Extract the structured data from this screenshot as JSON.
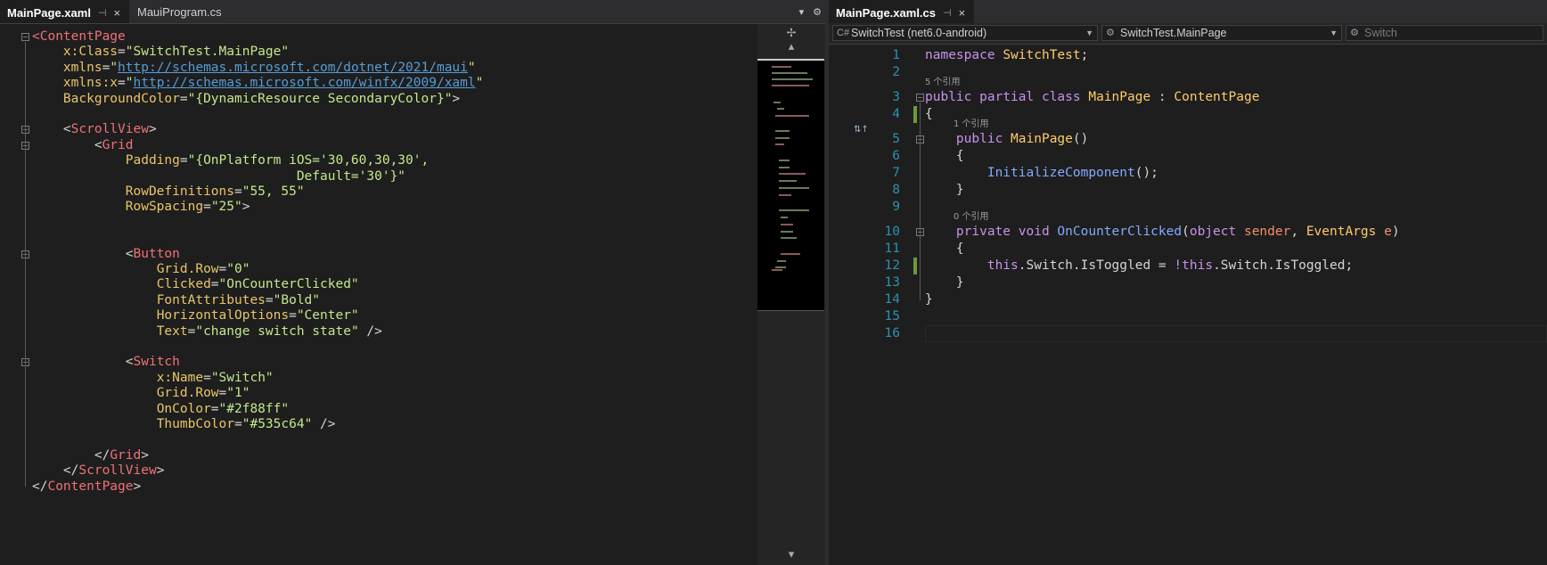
{
  "left": {
    "tabs": [
      {
        "label": "MainPage.xaml",
        "active": true
      },
      {
        "label": "MauiProgram.cs",
        "active": false
      }
    ],
    "tools": {
      "dropdown_icon": "chevron-down-icon",
      "settings_icon": "gear-icon"
    },
    "lines": [
      [
        [
          "<",
          "xt"
        ],
        [
          "ContentPage",
          "xt"
        ]
      ],
      [
        [
          "    ",
          ""
        ],
        [
          "x:Class",
          "xp"
        ],
        [
          "=",
          ""
        ],
        [
          "\"SwitchTest.MainPage\"",
          "xs"
        ]
      ],
      [
        [
          "    ",
          ""
        ],
        [
          "xmlns",
          "xp"
        ],
        [
          "=",
          ""
        ],
        [
          "\"",
          "xs"
        ],
        [
          "http://schemas.microsoft.com/dotnet/2021/maui",
          "xu"
        ],
        [
          "\"",
          "xs"
        ]
      ],
      [
        [
          "    ",
          ""
        ],
        [
          "xmlns:x",
          "xp"
        ],
        [
          "=",
          ""
        ],
        [
          "\"",
          "xs"
        ],
        [
          "http://schemas.microsoft.com/winfx/2009/xaml",
          "xu"
        ],
        [
          "\"",
          "xs"
        ]
      ],
      [
        [
          "    ",
          ""
        ],
        [
          "BackgroundColor",
          "xp"
        ],
        [
          "=",
          ""
        ],
        [
          "\"{DynamicResource SecondaryColor}\"",
          "xs"
        ],
        [
          ">",
          "xd"
        ]
      ],
      [],
      [
        [
          "    ",
          ""
        ],
        [
          "<",
          "xd"
        ],
        [
          "ScrollView",
          "xt"
        ],
        [
          ">",
          "xd"
        ]
      ],
      [
        [
          "        ",
          ""
        ],
        [
          "<",
          "xd"
        ],
        [
          "Grid",
          "xt"
        ]
      ],
      [
        [
          "            ",
          ""
        ],
        [
          "Padding",
          "xp"
        ],
        [
          "=",
          ""
        ],
        [
          "\"{OnPlatform iOS='30,60,30,30',",
          "xs"
        ]
      ],
      [
        [
          "                                  ",
          ""
        ],
        [
          "Default='30'}\"",
          "xs"
        ]
      ],
      [
        [
          "            ",
          ""
        ],
        [
          "RowDefinitions",
          "xp"
        ],
        [
          "=",
          ""
        ],
        [
          "\"55, 55\"",
          "xs"
        ]
      ],
      [
        [
          "            ",
          ""
        ],
        [
          "RowSpacing",
          "xp"
        ],
        [
          "=",
          ""
        ],
        [
          "\"25\"",
          "xs"
        ],
        [
          ">",
          "xd"
        ]
      ],
      [],
      [],
      [
        [
          "            ",
          ""
        ],
        [
          "<",
          "xd"
        ],
        [
          "Button",
          "xt"
        ]
      ],
      [
        [
          "                ",
          ""
        ],
        [
          "Grid.Row",
          "xp"
        ],
        [
          "=",
          ""
        ],
        [
          "\"0\"",
          "xs"
        ]
      ],
      [
        [
          "                ",
          ""
        ],
        [
          "Clicked",
          "xp"
        ],
        [
          "=",
          ""
        ],
        [
          "\"OnCounterClicked\"",
          "xs"
        ]
      ],
      [
        [
          "                ",
          ""
        ],
        [
          "FontAttributes",
          "xp"
        ],
        [
          "=",
          ""
        ],
        [
          "\"Bold\"",
          "xs"
        ]
      ],
      [
        [
          "                ",
          ""
        ],
        [
          "HorizontalOptions",
          "xp"
        ],
        [
          "=",
          ""
        ],
        [
          "\"Center\"",
          "xs"
        ]
      ],
      [
        [
          "                ",
          ""
        ],
        [
          "Text",
          "xp"
        ],
        [
          "=",
          ""
        ],
        [
          "\"change switch state\"",
          "xs"
        ],
        [
          " />",
          "xd"
        ]
      ],
      [],
      [
        [
          "            ",
          ""
        ],
        [
          "<",
          "xd"
        ],
        [
          "Switch",
          "xt"
        ]
      ],
      [
        [
          "                ",
          ""
        ],
        [
          "x:Name",
          "xp"
        ],
        [
          "=",
          ""
        ],
        [
          "\"Switch\"",
          "xs"
        ]
      ],
      [
        [
          "                ",
          ""
        ],
        [
          "Grid.Row",
          "xp"
        ],
        [
          "=",
          ""
        ],
        [
          "\"1\"",
          "xs"
        ]
      ],
      [
        [
          "                ",
          ""
        ],
        [
          "OnColor",
          "xp"
        ],
        [
          "=",
          ""
        ],
        [
          "\"#2f88ff\"",
          "xs"
        ]
      ],
      [
        [
          "                ",
          ""
        ],
        [
          "ThumbColor",
          "xp"
        ],
        [
          "=",
          ""
        ],
        [
          "\"#535c64\"",
          "xs"
        ],
        [
          " />",
          "xd"
        ]
      ],
      [],
      [
        [
          "        ",
          ""
        ],
        [
          "</",
          "xd"
        ],
        [
          "Grid",
          "xt"
        ],
        [
          ">",
          "xd"
        ]
      ],
      [
        [
          "    ",
          ""
        ],
        [
          "</",
          "xd"
        ],
        [
          "ScrollView",
          "xt"
        ],
        [
          ">",
          "xd"
        ]
      ],
      [
        [
          "</",
          "xd"
        ],
        [
          "ContentPage",
          "xt"
        ],
        [
          ">",
          "xd"
        ]
      ]
    ]
  },
  "right": {
    "tabs": [
      {
        "label": "MainPage.xaml.cs",
        "active": true
      }
    ],
    "nav": {
      "project": "SwitchTest (net6.0-android)",
      "type": "SwitchTest.MainPage",
      "member": "Switch"
    },
    "codelens": [
      "5 个引用",
      "1 个引用",
      "0 个引用"
    ],
    "line_numbers": [
      "1",
      "2",
      "3",
      "4",
      "5",
      "6",
      "7",
      "8",
      "9",
      "10",
      "11",
      "12",
      "13",
      "14",
      "15",
      "16"
    ],
    "lines": [
      [
        [
          "namespace",
          "ck"
        ],
        [
          " ",
          ""
        ],
        [
          "SwitchTest",
          "cc"
        ],
        [
          ";",
          "cd"
        ]
      ],
      [],
      [
        [
          "public",
          "ck"
        ],
        [
          " ",
          ""
        ],
        [
          "partial",
          "ck"
        ],
        [
          " ",
          ""
        ],
        [
          "class",
          "ck"
        ],
        [
          " ",
          ""
        ],
        [
          "MainPage",
          "cc"
        ],
        [
          " : ",
          ""
        ],
        [
          "ContentPage",
          "cc"
        ]
      ],
      [
        [
          "{",
          "cd"
        ]
      ],
      [
        [
          "    ",
          ""
        ],
        [
          "public",
          "ck"
        ],
        [
          " ",
          ""
        ],
        [
          "MainPage",
          "cc"
        ],
        [
          "()",
          "cd"
        ]
      ],
      [
        [
          "    ",
          ""
        ],
        [
          "{",
          "cd"
        ]
      ],
      [
        [
          "        ",
          ""
        ],
        [
          "InitializeComponent",
          "cm"
        ],
        [
          "();",
          "cd"
        ]
      ],
      [
        [
          "    ",
          ""
        ],
        [
          "}",
          "cd"
        ]
      ],
      [],
      [
        [
          "    ",
          ""
        ],
        [
          "private",
          "ck"
        ],
        [
          " ",
          ""
        ],
        [
          "void",
          "ck"
        ],
        [
          " ",
          ""
        ],
        [
          "OnCounterClicked",
          "cm"
        ],
        [
          "(",
          "cd"
        ],
        [
          "object",
          "ck"
        ],
        [
          " ",
          ""
        ],
        [
          "sender",
          "cp"
        ],
        [
          ", ",
          ""
        ],
        [
          "EventArgs",
          "cc"
        ],
        [
          " ",
          ""
        ],
        [
          "e",
          "cp"
        ],
        [
          ")",
          "cd"
        ]
      ],
      [
        [
          "    ",
          ""
        ],
        [
          "{",
          "cd"
        ]
      ],
      [
        [
          "        ",
          ""
        ],
        [
          "this",
          "ck"
        ],
        [
          ".",
          "cd"
        ],
        [
          "Switch",
          "ci"
        ],
        [
          ".",
          "cd"
        ],
        [
          "IsToggled",
          "ci"
        ],
        [
          " = ",
          ""
        ],
        [
          "!",
          "ck"
        ],
        [
          "this",
          "ck"
        ],
        [
          ".",
          "cd"
        ],
        [
          "Switch",
          "ci"
        ],
        [
          ".",
          "cd"
        ],
        [
          "IsToggled",
          "ci"
        ],
        [
          ";",
          "cd"
        ]
      ],
      [
        [
          "    ",
          ""
        ],
        [
          "}",
          "cd"
        ]
      ],
      [
        [
          "}",
          "cd"
        ]
      ],
      [],
      []
    ]
  }
}
